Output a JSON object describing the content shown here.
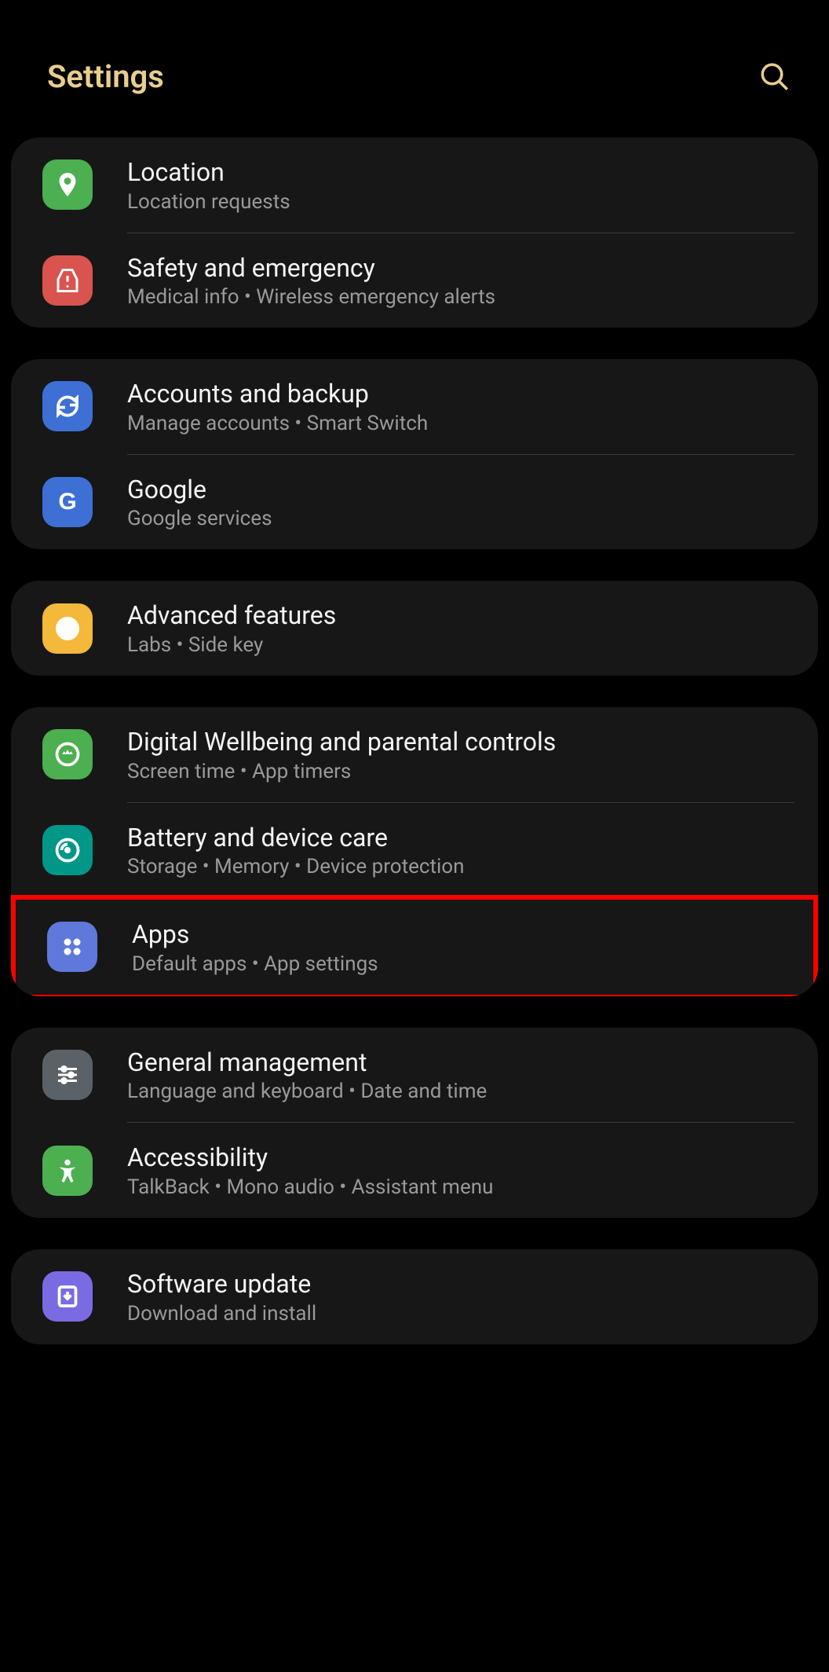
{
  "header": {
    "title": "Settings"
  },
  "groups": [
    {
      "items": [
        {
          "id": "location",
          "title": "Location",
          "subtitle": "Location requests",
          "iconBg": "bg-green",
          "iconName": "location-pin-icon"
        },
        {
          "id": "safety",
          "title": "Safety and emergency",
          "subtitle": "Medical info  •  Wireless emergency alerts",
          "iconBg": "bg-red",
          "iconName": "warning-icon"
        }
      ]
    },
    {
      "items": [
        {
          "id": "accounts",
          "title": "Accounts and backup",
          "subtitle": "Manage accounts  •  Smart Switch",
          "iconBg": "bg-blue",
          "iconName": "sync-icon"
        },
        {
          "id": "google",
          "title": "Google",
          "subtitle": "Google services",
          "iconBg": "bg-blue",
          "iconName": "google-icon"
        }
      ]
    },
    {
      "items": [
        {
          "id": "advanced",
          "title": "Advanced features",
          "subtitle": "Labs  •  Side key",
          "iconBg": "bg-orange",
          "iconName": "plus-circle-icon"
        }
      ]
    },
    {
      "items": [
        {
          "id": "wellbeing",
          "title": "Digital Wellbeing and parental controls",
          "subtitle": "Screen time  •  App timers",
          "iconBg": "bg-green",
          "iconName": "wellbeing-icon"
        },
        {
          "id": "battery",
          "title": "Battery and device care",
          "subtitle": "Storage  •  Memory  •  Device protection",
          "iconBg": "bg-teal",
          "iconName": "device-care-icon"
        },
        {
          "id": "apps",
          "title": "Apps",
          "subtitle": "Default apps  •  App settings",
          "iconBg": "bg-blue-light",
          "iconName": "apps-grid-icon",
          "highlighted": true
        }
      ]
    },
    {
      "items": [
        {
          "id": "general",
          "title": "General management",
          "subtitle": "Language and keyboard  •  Date and time",
          "iconBg": "bg-gray",
          "iconName": "sliders-icon"
        },
        {
          "id": "accessibility",
          "title": "Accessibility",
          "subtitle": "TalkBack  •  Mono audio  •  Assistant menu",
          "iconBg": "bg-green",
          "iconName": "accessibility-icon"
        }
      ]
    },
    {
      "items": [
        {
          "id": "software",
          "title": "Software update",
          "subtitle": "Download and install",
          "iconBg": "bg-purple",
          "iconName": "download-icon"
        }
      ]
    }
  ]
}
